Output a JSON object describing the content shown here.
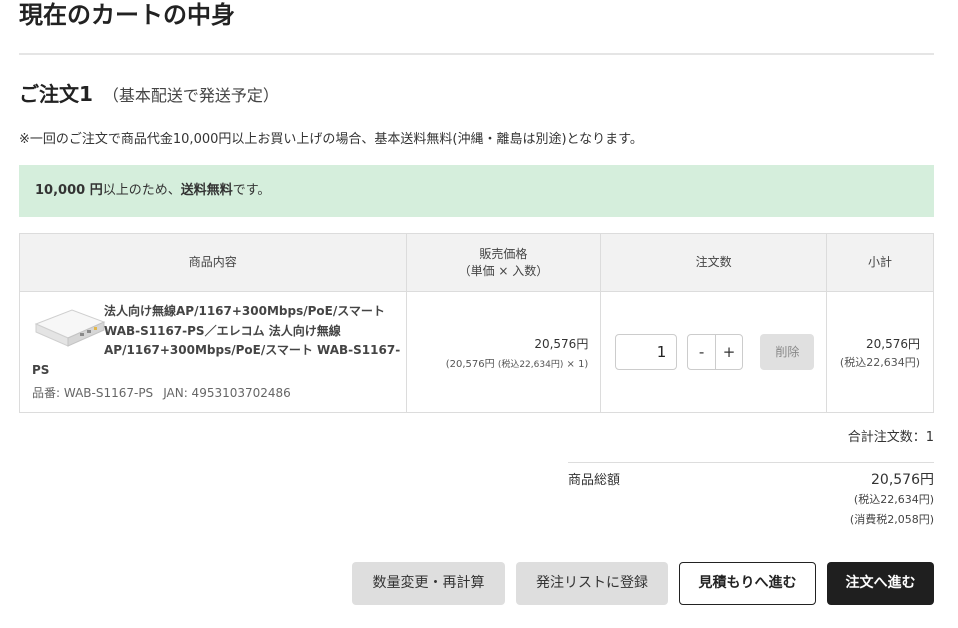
{
  "page": {
    "title": "現在のカートの中身"
  },
  "order": {
    "heading": "ご注文1",
    "shipping_note": "（基本配送で発送予定）",
    "notice": "※一回のご注文で商品代金10,000円以上お買い上げの場合、基本送料無料(沖縄・離島は別途)となります。",
    "free_amount": "10,000 円",
    "free_mid": "以上のため、",
    "free_bold": "送料無料",
    "free_end": "です。"
  },
  "table": {
    "headers": {
      "product": "商品内容",
      "price_line1": "販売価格",
      "price_line2": "（単価 × 入数）",
      "qty": "注文数",
      "subtotal": "小計"
    },
    "row": {
      "name": "法人向け無線AP/1167+300Mbps/PoE/スマート WAB-S1167-PS／エレコム 法人向け無線AP/1167+300Mbps/PoE/スマート WAB-S1167-PS",
      "code": "品番: WAB-S1167-PS",
      "jan": "JAN: 4953103702486",
      "price": "20,576円",
      "breakdown_a": "(20,576円 ",
      "breakdown_tax": "(税込22,634円)",
      "breakdown_b": " × 1)",
      "qty": "1",
      "minus": "-",
      "plus": "+",
      "delete": "削除",
      "subtotal": "20,576円",
      "subtotal_tax": "(税込22,634円)"
    }
  },
  "summary": {
    "count": "合計注文数：",
    "count_value": "1",
    "label": "商品総額",
    "total": "20,576円",
    "incl_tax": "(税込22,634円)",
    "consumption_tax": "(消費税2,058円)"
  },
  "buttons": {
    "recalc": "数量変更・再計算",
    "order_list": "発注リストに登録",
    "quote": "見積もりへ進む",
    "checkout": "注文へ進む"
  }
}
